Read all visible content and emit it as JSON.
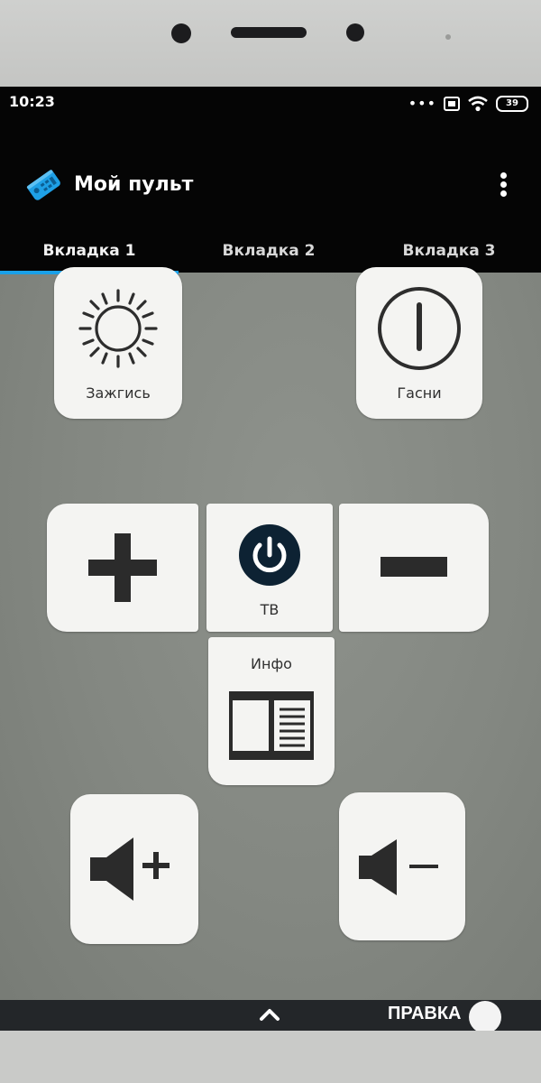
{
  "status_bar": {
    "time": "10:23",
    "battery": "39"
  },
  "app": {
    "title": "Мой пульт",
    "logo_icon": "remote-control-icon",
    "accent": "#1aa0e8"
  },
  "tabs": [
    {
      "label": "Вкладка 1",
      "active": true
    },
    {
      "label": "Вкладка 2",
      "active": false
    },
    {
      "label": "Вкладка 3",
      "active": false
    }
  ],
  "buttons": {
    "light_on": {
      "label": "Зажгись",
      "icon": "sun-icon"
    },
    "light_off": {
      "label": "Гасни",
      "icon": "power-ring-icon"
    },
    "plus": {
      "icon": "plus-icon"
    },
    "tv": {
      "label": "ТВ",
      "icon": "power-icon"
    },
    "minus": {
      "icon": "minus-icon"
    },
    "info": {
      "label": "Инфо",
      "icon": "book-icon"
    },
    "volume_up": {
      "icon": "volume-up-icon"
    },
    "volume_down": {
      "icon": "volume-down-icon"
    }
  },
  "bottom_bar": {
    "edit_label": "ПРАВКА",
    "edit_toggle_on": false
  }
}
